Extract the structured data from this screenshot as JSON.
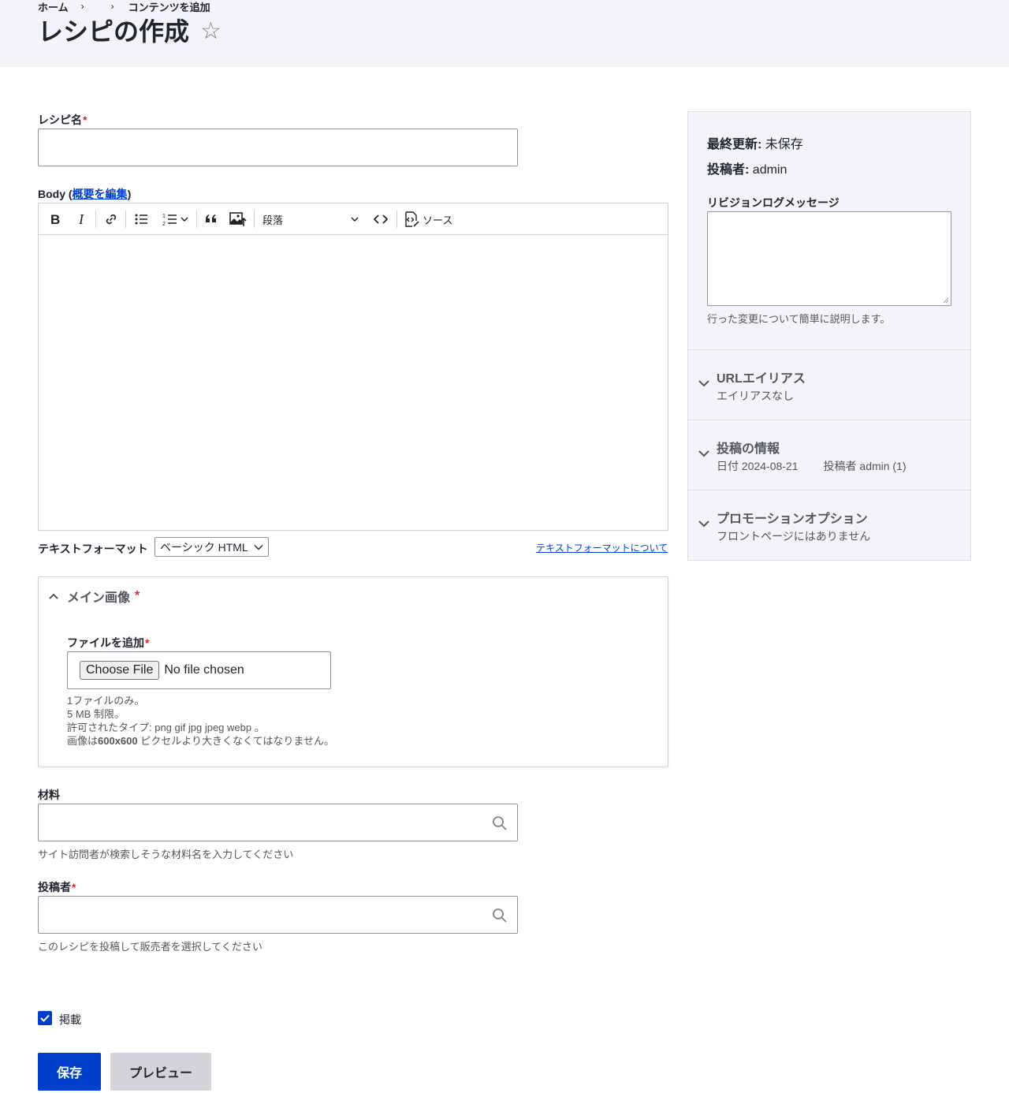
{
  "breadcrumb": {
    "home": "ホーム",
    "sep1": "›",
    "sep2": "›",
    "current": "コンテンツを追加"
  },
  "page": {
    "title": "レシピの作成",
    "star_icon": "☆"
  },
  "recipe_name": {
    "label": "レシピ名",
    "required": "*"
  },
  "body": {
    "label_prefix": "Body (",
    "summary_link": "概要を編集",
    "label_suffix": ")"
  },
  "toolbar": {
    "heading_value": "段落",
    "source_label": "ソース"
  },
  "text_format": {
    "label": "テキストフォーマット",
    "selected": "ベーシック HTML",
    "help_link": "テキストフォーマットについて"
  },
  "main_image": {
    "summary": "メイン画像",
    "required": "*",
    "add_file_label": "ファイルを追加",
    "choose_file": "Choose File",
    "no_file": "No file chosen",
    "desc_1": "1ファイルのみ。",
    "desc_2": "5 MB 制限。",
    "desc_3": "許可されたタイプ: png gif jpg jpeg webp 。",
    "desc_4_prefix": "画像は",
    "desc_4_bold": "600x600",
    "desc_4_suffix": " ピクセルより大きくなくてはなりません。"
  },
  "ingredients": {
    "label": "材料",
    "description": "サイト訪問者が検索しそうな材料名を入力してください"
  },
  "author": {
    "label": "投稿者",
    "required": "*",
    "description": "このレシピを投稿して販売者を選択してください"
  },
  "published": {
    "label": "掲載",
    "checked": true
  },
  "buttons": {
    "save": "保存",
    "preview": "プレビュー"
  },
  "sidebar": {
    "last_updated_label": "最終更新:",
    "last_updated_value": "未保存",
    "author_label": "投稿者:",
    "author_value": "admin",
    "revision_label": "リビジョンログメッセージ",
    "revision_desc": "行った変更について簡単に説明します。",
    "sections": [
      {
        "title": "URLエイリアス",
        "sub": "エイリアスなし"
      },
      {
        "title": "投稿の情報",
        "sub_date": "日付 2024-08-21",
        "sub_author": "投稿者 admin (1)"
      },
      {
        "title": "プロモーションオプション",
        "sub": "フロントページにはありません"
      }
    ]
  },
  "colors": {
    "accent": "#003ecc",
    "required": "#dc2323",
    "header_bg": "#f3f4f9"
  }
}
